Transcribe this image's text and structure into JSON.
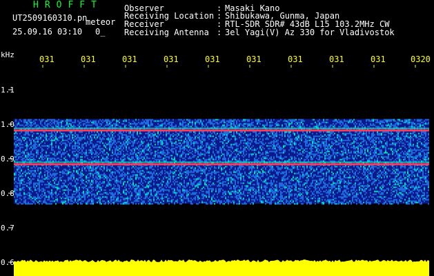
{
  "header": {
    "title": "HROFFT",
    "file_name": "UT2509160310.pn",
    "file_type": "meteor",
    "date_time": "25.09.16 03:10",
    "sequence": "0_"
  },
  "meta": [
    {
      "label": "Observer",
      "value": "Masaki Kano"
    },
    {
      "label": "Receiving Location",
      "value": "Shibukawa, Gunma, Japan"
    },
    {
      "label": "Receiver",
      "value": "RTL-SDR SDR# 43dB L15 103.2MHz CW"
    },
    {
      "label": "Receiving Antenna",
      "value": "3el Yagi(V) Az 330 for Vladivostok"
    }
  ],
  "meta_colon": ":",
  "colors": {
    "background": "#000000",
    "title": "#00ff33",
    "text": "#ffffff",
    "time_ticks": "#ffff00",
    "noise_floor": "#ffff00",
    "band_low": "#0a1a8a",
    "band_mid": "#1e6ae0",
    "band_high": "#00e0c0",
    "carrier": "#ff3a5a"
  },
  "chart_data": {
    "type": "heatmap",
    "ylabel": "kHz",
    "y_ticks": [
      "1.1",
      "1.0",
      "0.9",
      "0.8",
      "0.7",
      "0.6"
    ],
    "x_ticks": [
      "031",
      "031",
      "031",
      "031",
      "031",
      "031",
      "031",
      "031",
      "031",
      "0320"
    ],
    "ylim": [
      0.6,
      1.15
    ],
    "bands": [
      {
        "from": 0.77,
        "to": 1.015,
        "level": "mid"
      }
    ],
    "carriers": [
      0.982,
      0.884
    ],
    "noise_floor_level": 0.6
  }
}
